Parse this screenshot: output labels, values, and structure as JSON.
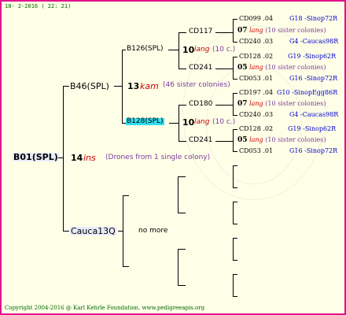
{
  "date": "18- 2-2016 ( 22: 21)",
  "copyright": "Copyright 2004-2016 @ Karl Kehrle Foundation.  www.pedigreeapis.org",
  "root": {
    "name": "B01(SPL)",
    "num": "14",
    "ins": "ins",
    "note": "(Drones from 1 single colony)"
  },
  "gen1": [
    {
      "name": "B46(SPL)",
      "num": "13",
      "kam": "kam",
      "note": "(46 sister colonies)"
    },
    {
      "name": "Cauca13Q",
      "note": "no more"
    }
  ],
  "gen2": [
    {
      "name": "B126(SPL)",
      "num": "10",
      "lang": "lang",
      "note": "(10 c.)"
    },
    {
      "name": "B128(SPL)",
      "num": "10",
      "lang": "lang",
      "note": "(10 c.)"
    }
  ],
  "gen3": [
    {
      "name": "CD117",
      "num": "07",
      "lang": "lang",
      "note": "(10 sister colonies)"
    },
    {
      "name": "CD241",
      "num": "05",
      "lang": "lang",
      "note": "(10 sister colonies)"
    },
    {
      "name": "CD180",
      "num": "07",
      "lang": "lang",
      "note": "(10 sister colonies)"
    },
    {
      "name": "CD241",
      "num": "05",
      "lang": "lang",
      "note": "(10 sister colonies)"
    }
  ],
  "gen4": [
    {
      "code": "CD099",
      "num": ".04",
      "src": "G18 -Sinop72R"
    },
    {
      "code": "CD240",
      "num": ".03",
      "src": "G4 -Caucas98R"
    },
    {
      "code": "CD128",
      "num": ".02",
      "src": "G19 -Sinop62R"
    },
    {
      "code": "CD053",
      "num": ".01",
      "src": "G16 -Sinop72R"
    },
    {
      "code": "CD197",
      "num": ".04",
      "src": "G10 -SinopEgg86R"
    },
    {
      "code": "CD240",
      "num": ".03",
      "src": "G4 -Caucas98R"
    },
    {
      "code": "CD128",
      "num": ".02",
      "src": "G19 -Sinop62R"
    },
    {
      "code": "CD053",
      "num": ".01",
      "src": "G16 -Sinop72R"
    }
  ]
}
